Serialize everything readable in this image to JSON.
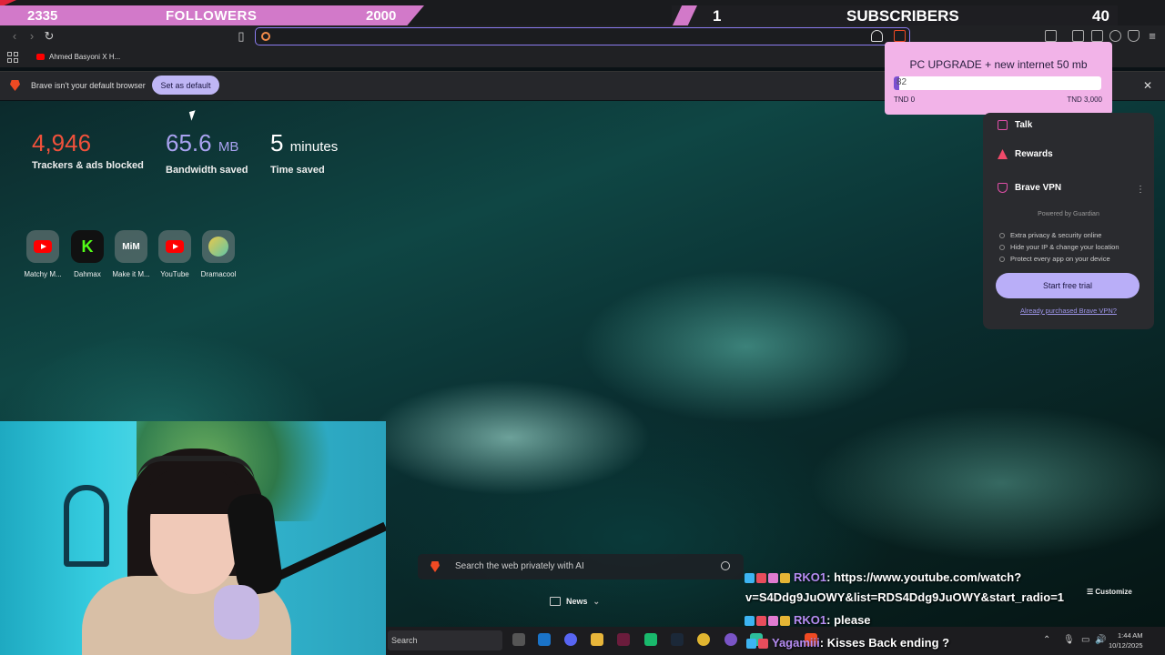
{
  "overlay": {
    "followers_current": "2335",
    "followers_label": "FOLLOWERS",
    "followers_goal": "2000",
    "subs_current": "1",
    "subs_label": "SUBSCRIBERS",
    "subs_goal": "40"
  },
  "bookmarks": {
    "item1": "Ahmed Basyoni X H..."
  },
  "infobar": {
    "message": "Brave isn't your default browser",
    "button": "Set as default"
  },
  "stats": {
    "trackers_value": "4,946",
    "trackers_label": "Trackers & ads blocked",
    "bandwidth_value": "65.6",
    "bandwidth_unit": "MB",
    "bandwidth_label": "Bandwidth saved",
    "time_value": "5",
    "time_unit": "minutes",
    "time_label": "Time saved"
  },
  "top_sites": [
    {
      "name": "Matchy M...",
      "icon": "youtube-icon"
    },
    {
      "name": "Dahmax",
      "icon": "kick-icon"
    },
    {
      "name": "Make it M...",
      "icon": "mim-icon"
    },
    {
      "name": "YouTube",
      "icon": "youtube-icon"
    },
    {
      "name": "Dramacool",
      "icon": "dramacool-icon"
    }
  ],
  "goal": {
    "title": "PC UPGRADE + new internet 50 mb",
    "current_text": "82",
    "progress_fraction": 0.027,
    "min_label": "TND 0",
    "max_label": "TND 3,000"
  },
  "panel": {
    "talk": "Talk",
    "rewards": "Rewards",
    "vpn": "Brave VPN",
    "powered": "Powered by  Guardian",
    "feat1": "Extra privacy & security online",
    "feat2": "Hide your IP & change your location",
    "feat3": "Protect every app on your device",
    "trial_button": "Start free trial",
    "already": "Already purchased Brave VPN?"
  },
  "search": {
    "placeholder": "Search the web privately with AI"
  },
  "news": {
    "label": "News"
  },
  "customize": {
    "label": "Customize"
  },
  "chat": [
    {
      "user": "RKO1",
      "msg": ": https://www.youtube.com/watch?",
      "cont": "v=S4Ddg9JuOWY&list=RDS4Ddg9JuOWY&start_radio=1"
    },
    {
      "user": "RKO1",
      "msg": ": please"
    },
    {
      "user": "Yagamiii",
      "msg": ": Kisses Back ending ?"
    }
  ],
  "taskbar": {
    "search": "Search",
    "time": "1:44 AM",
    "date": "10/12/2025"
  },
  "colors": {
    "accent": "#d279c9",
    "brave": "#f04a23",
    "trackers": "#f0513b",
    "bandwidth": "#a9a2f0"
  }
}
